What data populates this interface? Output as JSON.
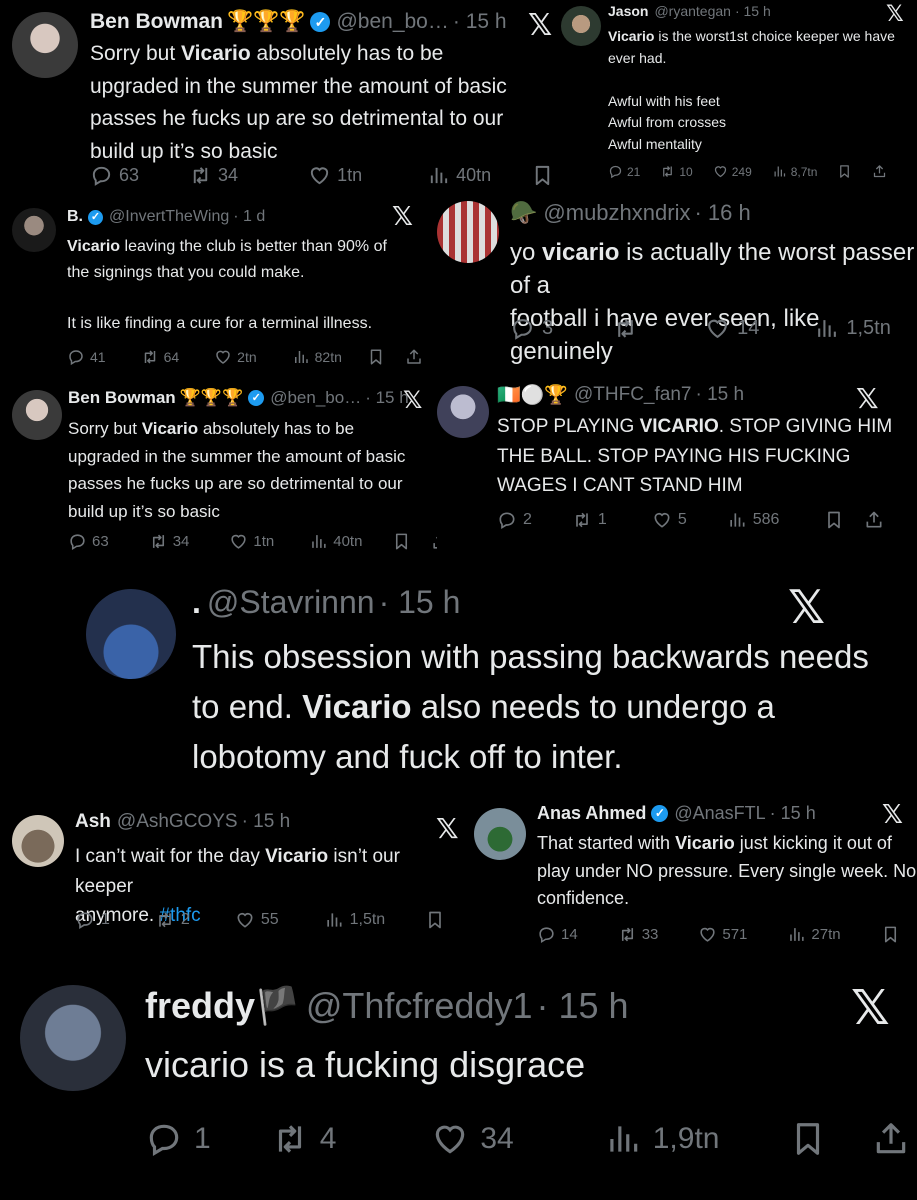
{
  "tweets": [
    {
      "name": "Ben Bowman",
      "badges": "🏆🏆🏆",
      "handle": "@ben_bo…",
      "time": "· 15 h",
      "lines": [
        "Sorry but |Vicario| absolutely has to be",
        "upgraded in the summer the amount of basic",
        "passes he fucks up are so detrimental to our",
        "build up it’s so basic"
      ],
      "replies": "63",
      "reposts": "34",
      "likes": "1tn",
      "views": "40tn"
    },
    {
      "name": "Jason",
      "handle": "@ryantegan",
      "time": "· 15 h",
      "lines": [
        "|Vicario| is the worst1st choice keeper we have",
        "ever had.",
        "",
        "Awful with his feet",
        "Awful from crosses",
        "Awful mentality"
      ],
      "replies": "21",
      "reposts": "10",
      "likes": "249",
      "views": "8,7tn"
    },
    {
      "name": "B.",
      "handle": "@InvertTheWing",
      "time": "· 1 d",
      "lines": [
        "|Vicario| leaving the club is better than 90% of",
        "the signings that you could make.",
        "",
        "It is like finding a cure for a terminal illness."
      ],
      "replies": "41",
      "reposts": "64",
      "likes": "2tn",
      "views": "82tn"
    },
    {
      "name": "🪖",
      "handle": "@mubzhxndrix",
      "time": "· 16 h",
      "lines": [
        "yo |vicario| is actually the worst passer of a",
        "football i have ever seen, like genuinely"
      ],
      "replies": "3",
      "reposts": "",
      "likes": "14",
      "views": "1,5tn"
    },
    {
      "name": "Ben Bowman",
      "badges": "🏆🏆🏆",
      "handle": "@ben_bo…",
      "time": "· 15 h",
      "lines": [
        "Sorry but |Vicario| absolutely has to be",
        "upgraded in the summer the amount of basic",
        "passes he fucks up are so detrimental to our",
        "build up it’s so basic"
      ],
      "replies": "63",
      "reposts": "34",
      "likes": "1tn",
      "views": "40tn"
    },
    {
      "name": "🇮🇪⚪🏆",
      "handle": "@THFC_fan7",
      "time": "· 15 h",
      "lines": [
        "STOP PLAYING |VICARIO|. STOP GIVING HIM",
        "THE BALL. STOP PAYING HIS FUCKING",
        "WAGES I CANT STAND HIM"
      ],
      "replies": "2",
      "reposts": "1",
      "likes": "5",
      "views": "586"
    },
    {
      "name": ".",
      "handle": "@Stavrinnn",
      "time": "· 15 h",
      "lines": [
        "This obsession with passing backwards needs",
        "to end. |Vicario| also needs to undergo a",
        "lobotomy and fuck off to inter."
      ]
    },
    {
      "name": "Ash",
      "handle": "@AshGCOYS",
      "time": "· 15 h",
      "lines": [
        "I can’t wait for the day |Vicario| isn’t our keeper",
        "anymore. #thfc"
      ],
      "replies": "1",
      "reposts": "2",
      "likes": "55",
      "views": "1,5tn"
    },
    {
      "name": "Anas Ahmed",
      "handle": "@AnasFTL",
      "time": "· 15 h",
      "lines": [
        "That started with |Vicario| just kicking it out of",
        "play under NO pressure. Every single week. No",
        "confidence."
      ],
      "replies": "14",
      "reposts": "33",
      "likes": "571",
      "views": "27tn"
    },
    {
      "name": "freddy🏴",
      "handle": "@Thfcfreddy1",
      "time": "· 15 h",
      "lines": [
        "vicario is a fucking disgrace"
      ],
      "replies": "1",
      "reposts": "4",
      "likes": "34",
      "views": "1,9tn"
    }
  ],
  "x_logo": "𝕏",
  "icons": [
    "reply-icon",
    "repost-icon",
    "like-icon",
    "views-icon",
    "bookmark-icon",
    "share-icon"
  ],
  "colors": {
    "background": "#000000",
    "text": "#e7e9ea",
    "muted": "#71767b",
    "verified": "#1d9bf0",
    "link": "#1d9bf0"
  }
}
